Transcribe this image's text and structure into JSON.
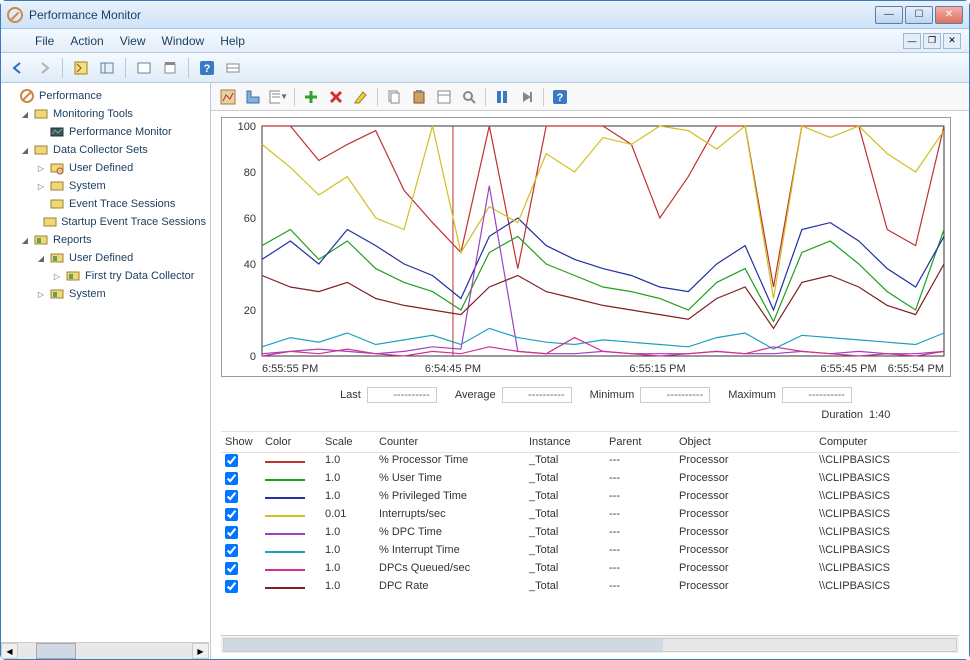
{
  "window": {
    "title": "Performance Monitor",
    "menus": [
      "File",
      "Action",
      "View",
      "Window",
      "Help"
    ]
  },
  "tree": {
    "root": "Performance",
    "monitoring_tools": "Monitoring Tools",
    "perfmon": "Performance Monitor",
    "dcs": "Data Collector Sets",
    "user_defined": "User Defined",
    "system": "System",
    "ets": "Event Trace Sessions",
    "sets": "Startup Event Trace Sessions",
    "reports": "Reports",
    "r_user_defined": "User Defined",
    "r_first": "First try  Data Collector",
    "r_system": "System"
  },
  "stats": {
    "last_label": "Last",
    "last_val": "----------",
    "avg_label": "Average",
    "avg_val": "----------",
    "min_label": "Minimum",
    "min_val": "----------",
    "max_label": "Maximum",
    "max_val": "----------",
    "dur_label": "Duration",
    "dur_val": "1:40"
  },
  "columns": {
    "show": "Show",
    "color": "Color",
    "scale": "Scale",
    "counter": "Counter",
    "instance": "Instance",
    "parent": "Parent",
    "object": "Object",
    "computer": "Computer"
  },
  "rows": [
    {
      "color": "#c03030",
      "scale": "1.0",
      "counter": "% Processor Time",
      "instance": "_Total",
      "parent": "---",
      "object": "Processor",
      "computer": "\\\\CLIPBASICS"
    },
    {
      "color": "#20a020",
      "scale": "1.0",
      "counter": "% User Time",
      "instance": "_Total",
      "parent": "---",
      "object": "Processor",
      "computer": "\\\\CLIPBASICS"
    },
    {
      "color": "#2030a0",
      "scale": "1.0",
      "counter": "% Privileged Time",
      "instance": "_Total",
      "parent": "---",
      "object": "Processor",
      "computer": "\\\\CLIPBASICS"
    },
    {
      "color": "#d0c020",
      "scale": "0.01",
      "counter": "Interrupts/sec",
      "instance": "_Total",
      "parent": "---",
      "object": "Processor",
      "computer": "\\\\CLIPBASICS"
    },
    {
      "color": "#a040c0",
      "scale": "1.0",
      "counter": "% DPC Time",
      "instance": "_Total",
      "parent": "---",
      "object": "Processor",
      "computer": "\\\\CLIPBASICS"
    },
    {
      "color": "#20a0c0",
      "scale": "1.0",
      "counter": "% Interrupt Time",
      "instance": "_Total",
      "parent": "---",
      "object": "Processor",
      "computer": "\\\\CLIPBASICS"
    },
    {
      "color": "#d03090",
      "scale": "1.0",
      "counter": "DPCs Queued/sec",
      "instance": "_Total",
      "parent": "---",
      "object": "Processor",
      "computer": "\\\\CLIPBASICS"
    },
    {
      "color": "#802020",
      "scale": "1.0",
      "counter": "DPC Rate",
      "instance": "_Total",
      "parent": "---",
      "object": "Processor",
      "computer": "\\\\CLIPBASICS"
    }
  ],
  "chart_data": {
    "type": "line",
    "title": "",
    "ylabel": "",
    "xlabel": "",
    "ylim": [
      0,
      100
    ],
    "y_ticks": [
      0,
      20,
      40,
      60,
      80,
      100
    ],
    "x_ticks": [
      "6:55:55 PM",
      "6:54:45 PM",
      "6:55:15 PM",
      "6:55:45 PM",
      "6:55:54 PM"
    ],
    "note": "Values sampled at 25 evenly spaced x positions across the visible range; each series ranges 0-100.",
    "series": [
      {
        "name": "% Processor Time",
        "color": "#c03030",
        "values": [
          100,
          100,
          85,
          92,
          98,
          72,
          58,
          45,
          100,
          38,
          100,
          100,
          100,
          92,
          60,
          78,
          100,
          100,
          30,
          100,
          100,
          100,
          55,
          48,
          100
        ]
      },
      {
        "name": "% User Time",
        "color": "#20a020",
        "values": [
          48,
          55,
          42,
          50,
          38,
          32,
          28,
          20,
          45,
          52,
          40,
          35,
          30,
          28,
          25,
          20,
          32,
          38,
          15,
          45,
          50,
          40,
          28,
          20,
          55
        ]
      },
      {
        "name": "% Privileged Time",
        "color": "#2030a0",
        "values": [
          42,
          50,
          40,
          55,
          48,
          40,
          35,
          25,
          52,
          60,
          48,
          42,
          38,
          35,
          30,
          28,
          40,
          48,
          20,
          55,
          58,
          50,
          38,
          30,
          52
        ]
      },
      {
        "name": "Interrupts/sec",
        "color": "#d0c020",
        "values": [
          92,
          82,
          70,
          78,
          60,
          55,
          100,
          45,
          65,
          58,
          88,
          80,
          95,
          92,
          100,
          98,
          90,
          100,
          25,
          100,
          95,
          100,
          88,
          80,
          98
        ]
      },
      {
        "name": "% DPC Time",
        "color": "#a040c0",
        "values": [
          1,
          2,
          3,
          2,
          1,
          2,
          4,
          3,
          74,
          2,
          1,
          1,
          2,
          1,
          1,
          1,
          2,
          1,
          1,
          2,
          1,
          2,
          1,
          1,
          2
        ]
      },
      {
        "name": "% Interrupt Time",
        "color": "#20a0c0",
        "values": [
          4,
          8,
          6,
          10,
          5,
          7,
          9,
          5,
          12,
          8,
          6,
          5,
          7,
          6,
          5,
          4,
          8,
          10,
          3,
          9,
          8,
          7,
          6,
          5,
          10
        ]
      },
      {
        "name": "DPCs Queued/sec",
        "color": "#d03090",
        "values": [
          0,
          2,
          1,
          3,
          1,
          0,
          2,
          1,
          4,
          2,
          1,
          8,
          2,
          1,
          0,
          1,
          2,
          1,
          4,
          2,
          1,
          0,
          1,
          0,
          2
        ]
      },
      {
        "name": "DPC Rate",
        "color": "#802020",
        "values": [
          35,
          30,
          28,
          32,
          25,
          22,
          20,
          18,
          30,
          35,
          28,
          25,
          22,
          20,
          18,
          16,
          25,
          30,
          12,
          32,
          35,
          30,
          22,
          18,
          40
        ]
      }
    ]
  }
}
